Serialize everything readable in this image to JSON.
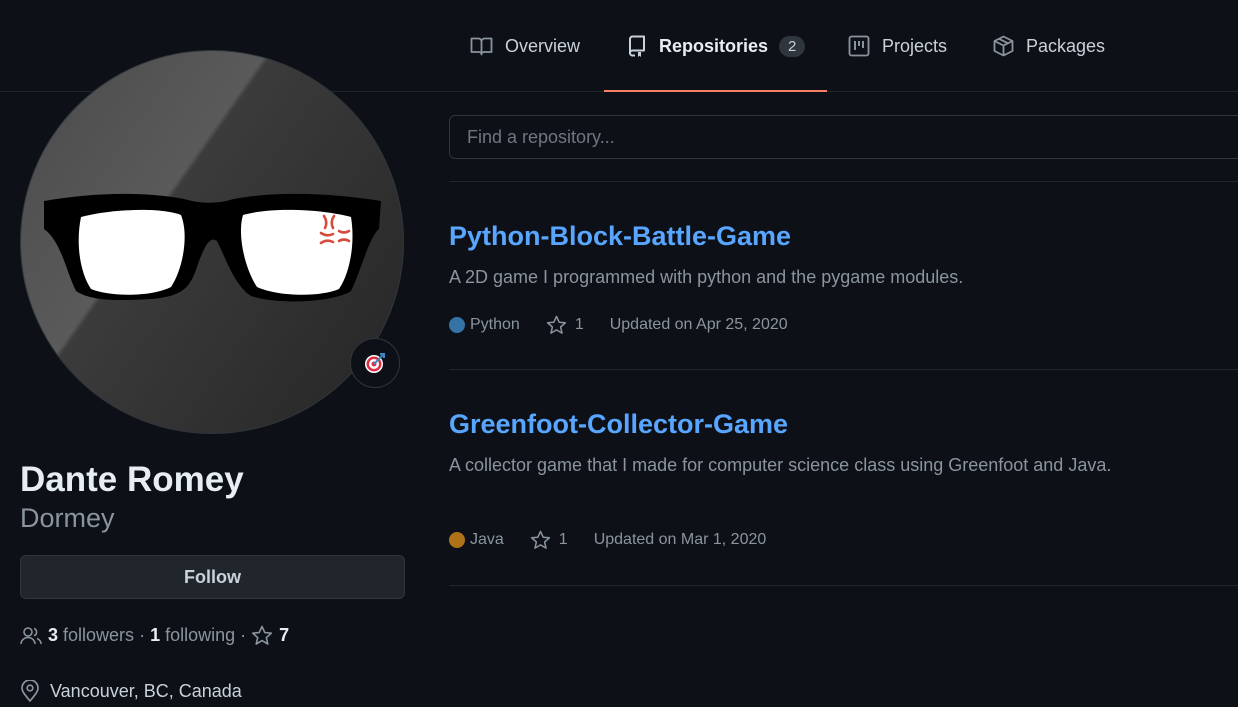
{
  "tabs": [
    {
      "label": "Overview",
      "icon": "book-icon"
    },
    {
      "label": "Repositories",
      "icon": "repo-icon",
      "count": "2",
      "selected": true
    },
    {
      "label": "Projects",
      "icon": "project-icon"
    },
    {
      "label": "Packages",
      "icon": "package-icon"
    }
  ],
  "profile": {
    "name": "Dante Romey",
    "login": "Dormey",
    "follow_label": "Follow",
    "followers_count": "3",
    "followers_label": "followers",
    "following_count": "1",
    "following_label": "following",
    "stars_count": "7",
    "location": "Vancouver, BC, Canada",
    "status_emoji": "🎯"
  },
  "search": {
    "placeholder": "Find a repository..."
  },
  "repos": [
    {
      "name": "Python-Block-Battle-Game",
      "description": "A 2D game I programmed with python and the pygame modules.",
      "language": "Python",
      "language_color": "#3572A5",
      "stars": "1",
      "updated": "Updated on Apr 25, 2020"
    },
    {
      "name": "Greenfoot-Collector-Game",
      "description": "A collector game that I made for computer science class using Greenfoot and Java.",
      "language": "Java",
      "language_color": "#b07219",
      "stars": "1",
      "updated": "Updated on Mar 1, 2020"
    }
  ],
  "colors": {
    "accent": "#f78166",
    "link": "#58a6ff",
    "background": "#0d1117"
  }
}
